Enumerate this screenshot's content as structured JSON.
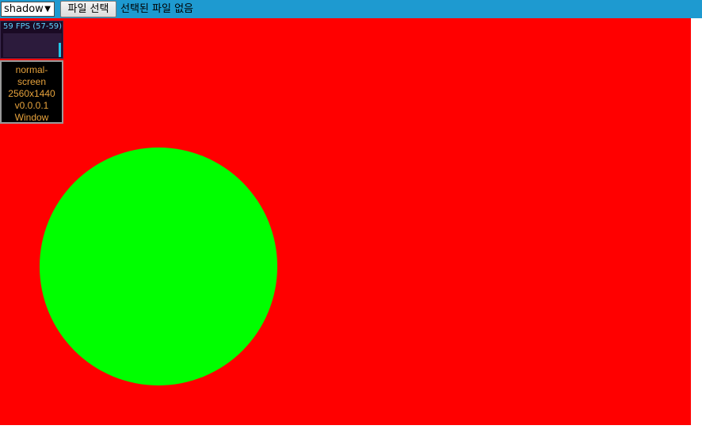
{
  "toolbar": {
    "select_value": "shadow",
    "select_arrow": "▼",
    "file_button_label": "파일 선택",
    "file_status": "선택된 파일 없음"
  },
  "stats": {
    "fps_text": "59 FPS (57-59)"
  },
  "info": {
    "lines": [
      "normal-",
      "screen",
      "2560x1440",
      "v0.0.0.1",
      "Window"
    ]
  },
  "colors": {
    "toolbar_bg": "#1e9ad0",
    "canvas_bg": "#ff0000",
    "circle_fill": "#00ff00",
    "fps_text": "#5fd3ff",
    "info_text": "#e6a23c"
  }
}
